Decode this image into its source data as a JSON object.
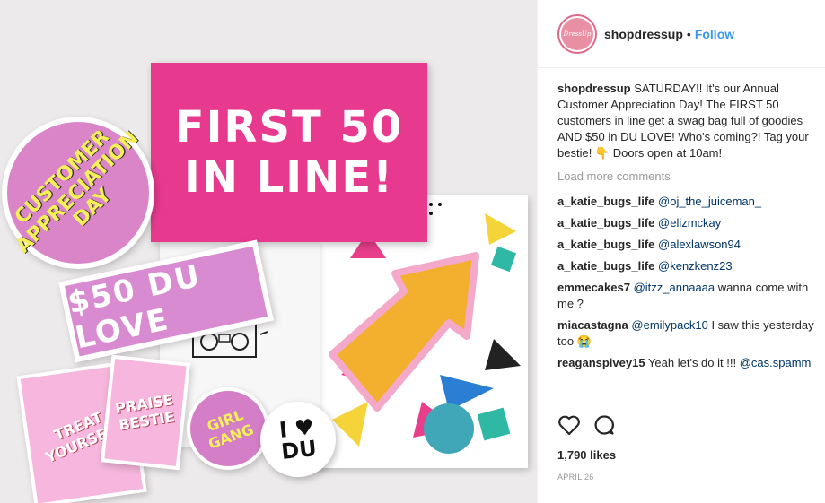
{
  "photo": {
    "card_title_line1": "FIRST 50",
    "card_title_line2": "IN LINE!",
    "circle_sticker_text": "CUSTOMER APPRECIATION DAY",
    "ticket_text": "$50 DU LOVE",
    "card_treat_text": "TREAT YOURSELF",
    "card_praise_text": "PRAISE BESTIE",
    "girl_gang_text": "GIRL GANG",
    "i_love_du_line1": "I ♥",
    "i_love_du_line2": "DU"
  },
  "header": {
    "avatar_text": "DressUp",
    "username": "shopdressup",
    "separator": "•",
    "follow_label": "Follow"
  },
  "caption": {
    "user": "shopdressup",
    "text": "SATURDAY!! It's our Annual Customer Appreciation Day! The FIRST 50 customers in line get a swag bag full of goodies AND $50 in DU LOVE! Who's coming?! Tag your bestie! 👇 Doors open at 10am!"
  },
  "load_more": "Load more comments",
  "comments": [
    {
      "user": "a_katie_bugs_life",
      "mention": "@oj_the_juiceman_",
      "text": ""
    },
    {
      "user": "a_katie_bugs_life",
      "mention": "@elizmckay",
      "text": ""
    },
    {
      "user": "a_katie_bugs_life",
      "mention": "@alexlawson94",
      "text": ""
    },
    {
      "user": "a_katie_bugs_life",
      "mention": "@kenzkenz23",
      "text": ""
    },
    {
      "user": "emmecakes7",
      "mention": "@itzz_annaaaa",
      "text": " wanna come with me ?"
    },
    {
      "user": "miacastagna",
      "mention": "@emilypack10",
      "text": " I saw this yesterday too 😭"
    },
    {
      "user": "reaganspivey15",
      "mention": "",
      "text": " Yeah let's do it !!! ",
      "mention2": "@cas.spamm"
    }
  ],
  "actions": {
    "like_icon": "heart-outline-icon",
    "comment_icon": "comment-bubble-icon"
  },
  "likes": "1,790 likes",
  "date": "APRIL 26",
  "colors": {
    "follow": "#3897f0",
    "mention": "#003569",
    "card_pink": "#e73a8f"
  }
}
